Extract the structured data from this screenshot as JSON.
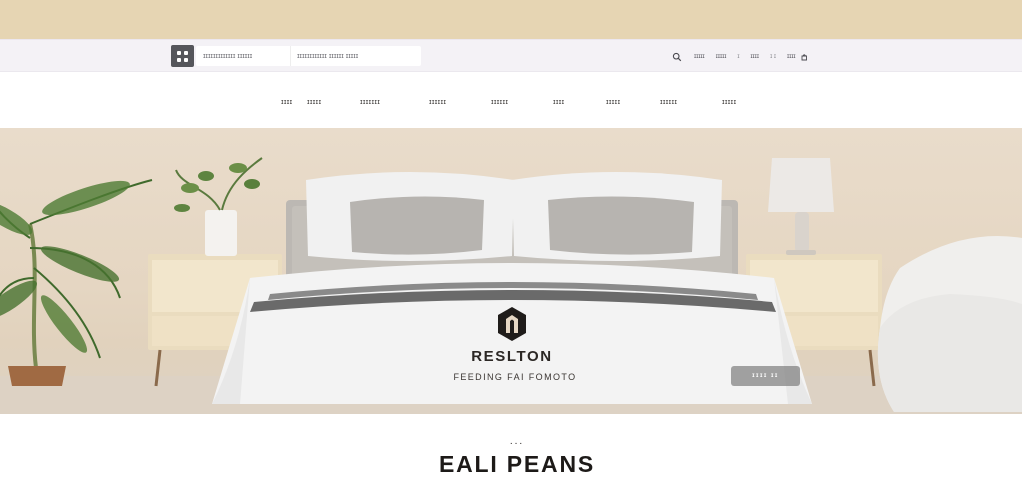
{
  "header": {
    "search": {
      "field_1_placeholder": "ɪɪɪɪɪɪɪɪɪɪɪɪɪ ɪɪɪɪɪɪ",
      "field_2_placeholder": "ɪɪɪɪɪɪɪɪɪɪɪɪ ɪɪɪɪɪɪ ɪɪɪɪɪ"
    },
    "utility_links": [
      "ɪɪɪɪɪ",
      "ɪɪɪɪɪ",
      "ɪɪɪɪ",
      "ɪɪɪɪ"
    ],
    "separators": [
      "ɪ",
      "ɪ ɪ"
    ]
  },
  "nav": {
    "items": [
      "ɪɪɪɪ",
      "ɪɪɪɪɪ",
      "ɪɪɪɪɪɪɪ",
      "ɪɪɪɪɪɪ",
      "ɪɪɪɪɪɪ",
      "ɪɪɪɪ",
      "ɪɪɪɪɪ",
      "ɪɪɪɪɪɪ",
      "ɪɪɪɪɪ"
    ]
  },
  "hero": {
    "brand": "RESLTON",
    "tagline": "FEEDING FAI FOMOTO",
    "cta_label": "ɪɪɪɪ ɪɪ"
  },
  "section": {
    "dots": "...",
    "title": "EALI PEANS"
  },
  "icons": {
    "menu": "grid-menu-icon",
    "search": "search-icon",
    "bag": "bag-icon",
    "brand": "brand-logo-icon"
  },
  "colors": {
    "top_band": "#e6d5b3",
    "utility_bar": "#f4f2f6",
    "menu_button": "#55565b",
    "hero_wall": "#e6d8c5",
    "cta": "#848484"
  }
}
